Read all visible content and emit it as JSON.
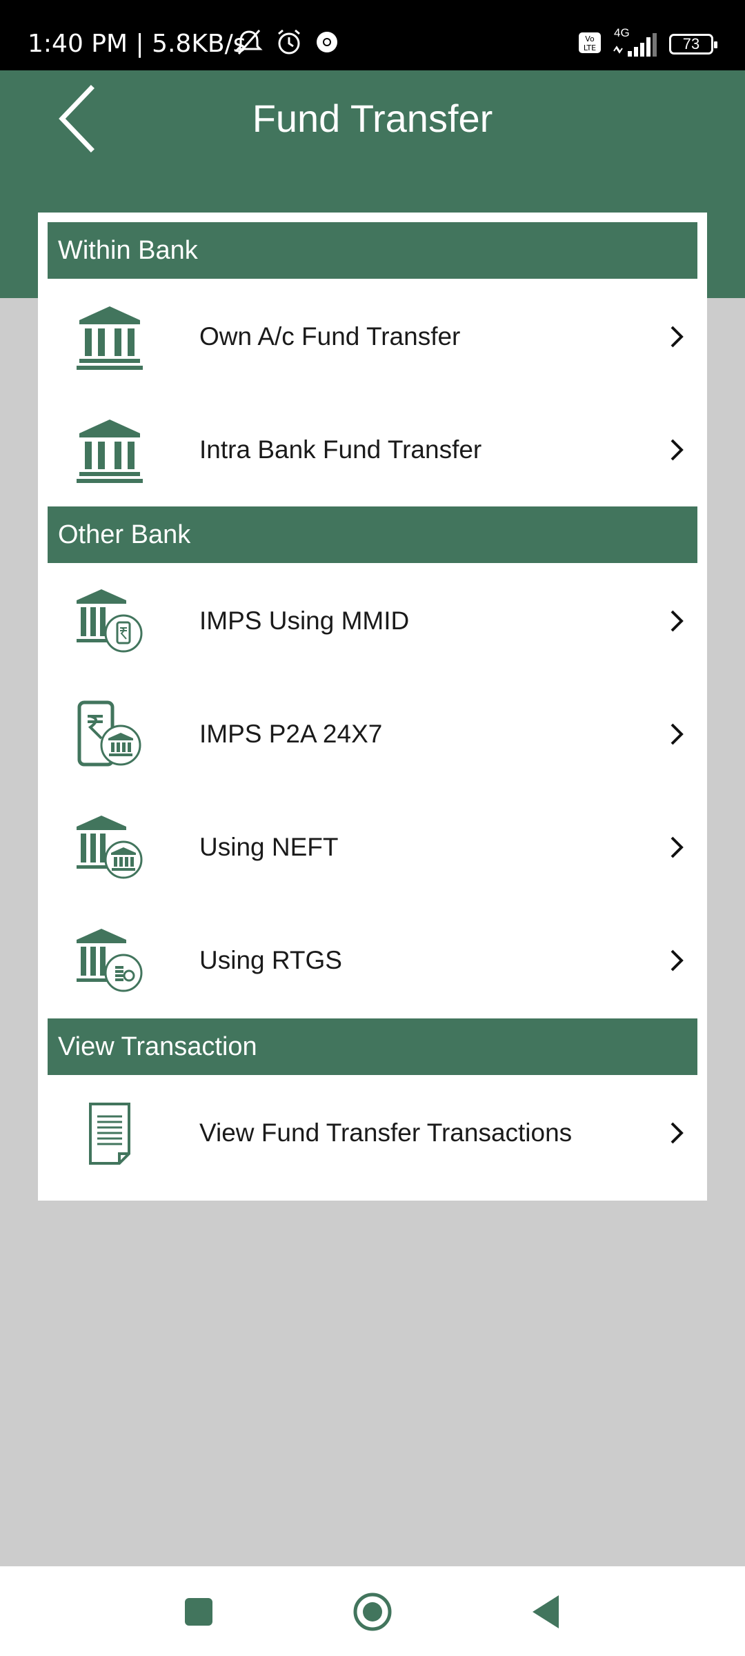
{
  "status_bar": {
    "time": "1:40 PM | 5.8KB/s",
    "network": "4G",
    "battery": "73",
    "icons": [
      "muted-alarm-icon",
      "alarm-clock-icon",
      "chrome-icon",
      "volte-icon",
      "signal-icon",
      "battery-icon"
    ]
  },
  "header": {
    "title": "Fund Transfer",
    "back_icon": "back-arrow-icon"
  },
  "colors": {
    "primary": "#42755d",
    "background": "#cccccc",
    "card": "#ffffff"
  },
  "sections": [
    {
      "title": "Within Bank",
      "items": [
        {
          "label": "Own A/c Fund Transfer",
          "icon": "bank-icon"
        },
        {
          "label": "Intra Bank Fund Transfer",
          "icon": "bank-icon"
        }
      ]
    },
    {
      "title": "Other Bank",
      "items": [
        {
          "label": "IMPS Using MMID",
          "icon": "bank-mobile-rupee-icon"
        },
        {
          "label": "IMPS P2A 24X7",
          "icon": "mobile-rupee-bank-icon"
        },
        {
          "label": "Using NEFT",
          "icon": "bank-transfer-icon"
        },
        {
          "label": "Using RTGS",
          "icon": "bank-coins-icon"
        }
      ]
    },
    {
      "title": "View Transaction",
      "items": [
        {
          "label": "View Fund Transfer Transactions",
          "icon": "document-icon"
        }
      ]
    }
  ],
  "nav_bar": {
    "icons": [
      "recents-square-icon",
      "home-circle-icon",
      "back-triangle-icon"
    ]
  }
}
